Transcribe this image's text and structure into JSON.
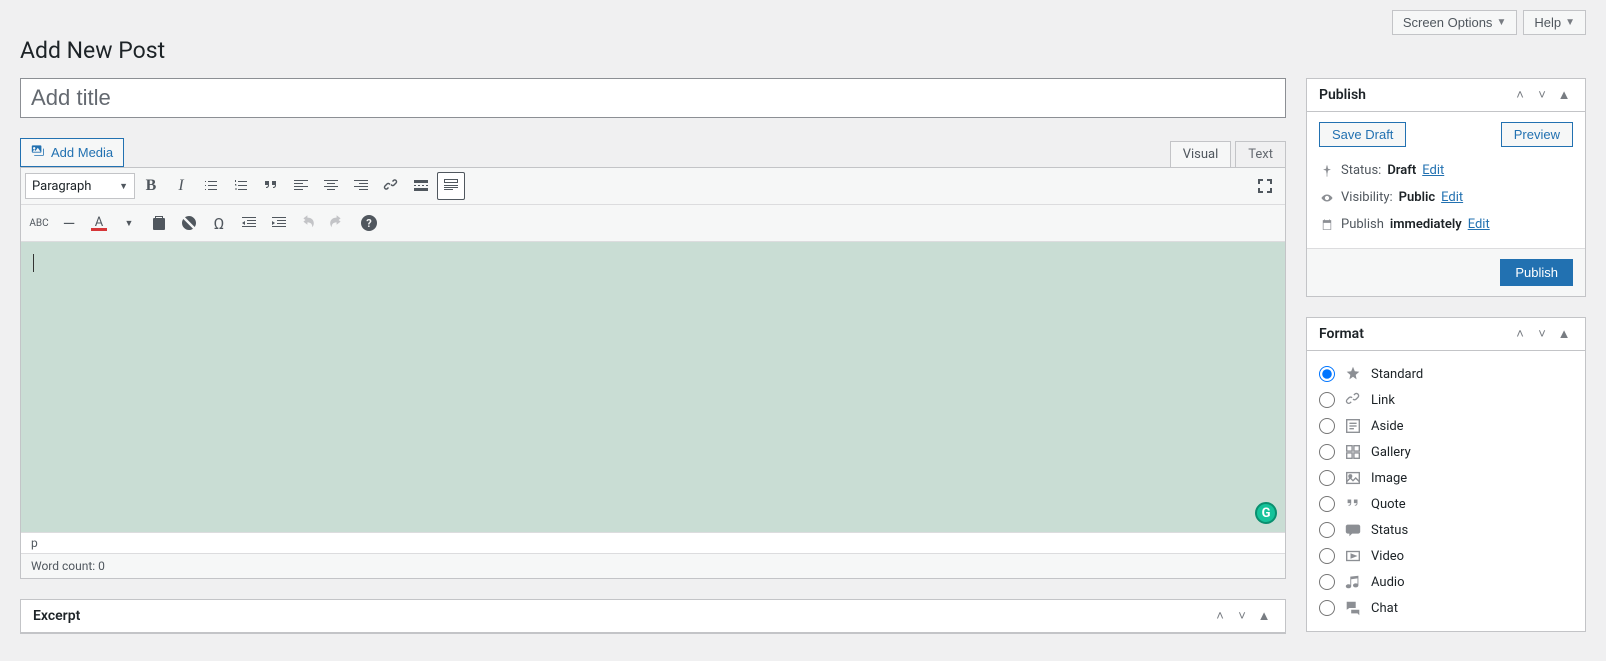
{
  "topbar": {
    "screen_options": "Screen Options",
    "help": "Help"
  },
  "page_title": "Add New Post",
  "title_placeholder": "Add title",
  "add_media": "Add Media",
  "editor_tabs": {
    "visual": "Visual",
    "text": "Text"
  },
  "format_dropdown": "Paragraph",
  "path_bar": "p",
  "word_count": "Word count: 0",
  "excerpt_title": "Excerpt",
  "publish": {
    "title": "Publish",
    "save_draft": "Save Draft",
    "preview": "Preview",
    "status_label": "Status:",
    "status_value": "Draft",
    "visibility_label": "Visibility:",
    "visibility_value": "Public",
    "schedule_label": "Publish",
    "schedule_value": "immediately",
    "edit": "Edit",
    "publish_btn": "Publish"
  },
  "format_box": {
    "title": "Format",
    "options": [
      "Standard",
      "Link",
      "Aside",
      "Gallery",
      "Image",
      "Quote",
      "Status",
      "Video",
      "Audio",
      "Chat"
    ]
  }
}
